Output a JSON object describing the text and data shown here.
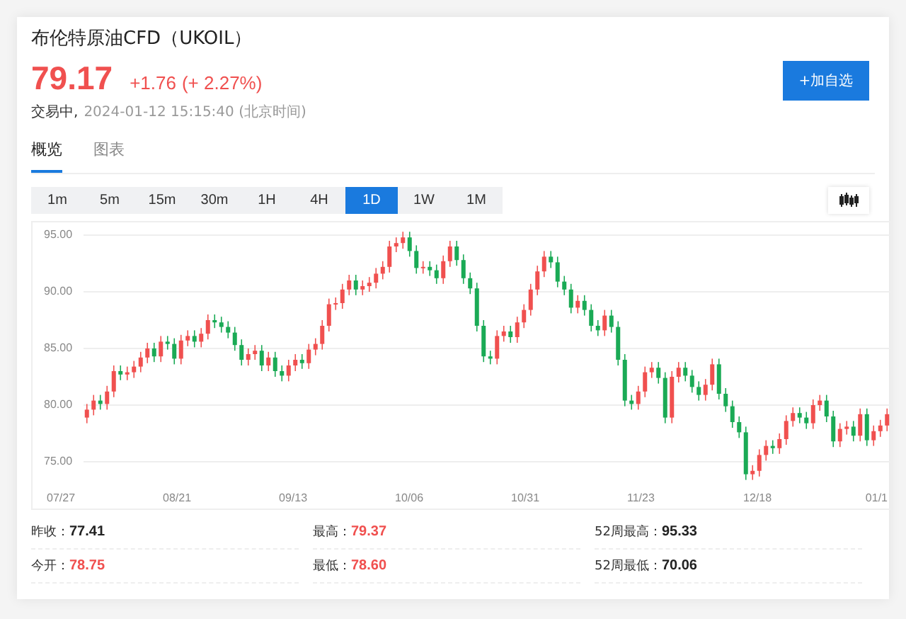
{
  "header": {
    "title": "布伦特原油CFD（UKOIL）",
    "price": "79.17",
    "change": "+1.76",
    "change_pct": "(+ 2.27%)",
    "color": "#f0504f",
    "status": "交易中,",
    "timestamp": "2024-01-12 15:15:40 (北京时间)",
    "watch_button": "+加自选"
  },
  "tabs": [
    {
      "label": "概览",
      "selected": true
    },
    {
      "label": "图表",
      "selected": false
    }
  ],
  "intervals": [
    {
      "label": "1m",
      "selected": false
    },
    {
      "label": "5m",
      "selected": false
    },
    {
      "label": "15m",
      "selected": false
    },
    {
      "label": "30m",
      "selected": false
    },
    {
      "label": "1H",
      "selected": false
    },
    {
      "label": "4H",
      "selected": false
    },
    {
      "label": "1D",
      "selected": true
    },
    {
      "label": "1W",
      "selected": false
    },
    {
      "label": "1M",
      "selected": false
    }
  ],
  "chart": {
    "x_labels": [
      "07/27",
      "08/21",
      "09/13",
      "10/06",
      "10/31",
      "11/23",
      "12/18",
      "01/1"
    ],
    "chart_data": {
      "type": "candlestick",
      "grid": true,
      "ylim": [
        70.875,
        96.125
      ],
      "yticks": [
        {
          "value": 95,
          "label": "95.00"
        },
        {
          "value": 90,
          "label": "90.00"
        },
        {
          "value": 85,
          "label": "85.00"
        },
        {
          "value": 80,
          "label": "80.00"
        },
        {
          "value": 75,
          "label": "75.00"
        }
      ],
      "ohlc": [
        [
          78.9,
          80.1,
          78.4,
          79.6
        ],
        [
          79.6,
          80.9,
          79.1,
          80.4
        ],
        [
          80.4,
          80.9,
          79.6,
          80.1
        ],
        [
          80.1,
          81.7,
          79.6,
          81.2
        ],
        [
          81.2,
          83.5,
          80.7,
          83.0
        ],
        [
          83.0,
          83.5,
          82.2,
          82.7
        ],
        [
          82.7,
          83.4,
          82.2,
          82.9
        ],
        [
          82.9,
          83.9,
          82.4,
          83.4
        ],
        [
          83.4,
          84.7,
          82.9,
          84.2
        ],
        [
          84.2,
          85.5,
          83.7,
          85.0
        ],
        [
          85.0,
          85.5,
          83.8,
          84.3
        ],
        [
          84.3,
          86.1,
          83.8,
          85.6
        ],
        [
          85.6,
          86.1,
          84.9,
          85.4
        ],
        [
          85.4,
          85.9,
          83.6,
          84.1
        ],
        [
          84.1,
          86.2,
          83.6,
          85.7
        ],
        [
          85.7,
          86.6,
          85.2,
          86.1
        ],
        [
          86.1,
          86.6,
          85.1,
          85.6
        ],
        [
          85.6,
          86.8,
          85.1,
          86.3
        ],
        [
          86.3,
          88.0,
          85.8,
          87.5
        ],
        [
          87.5,
          88.0,
          86.8,
          87.3
        ],
        [
          87.3,
          87.8,
          86.4,
          86.9
        ],
        [
          86.9,
          87.4,
          85.9,
          86.4
        ],
        [
          86.4,
          86.9,
          84.8,
          85.3
        ],
        [
          85.3,
          85.8,
          83.5,
          84.0
        ],
        [
          84.0,
          85.0,
          83.5,
          84.5
        ],
        [
          84.5,
          85.3,
          84.0,
          84.8
        ],
        [
          84.8,
          85.3,
          83.0,
          83.5
        ],
        [
          83.5,
          84.7,
          83.0,
          84.2
        ],
        [
          84.2,
          84.7,
          82.5,
          83.0
        ],
        [
          83.0,
          83.5,
          82.1,
          82.6
        ],
        [
          82.6,
          84.0,
          82.1,
          83.5
        ],
        [
          83.5,
          84.5,
          83.0,
          84.0
        ],
        [
          84.0,
          84.5,
          83.2,
          83.7
        ],
        [
          83.7,
          85.4,
          83.2,
          84.9
        ],
        [
          84.9,
          85.9,
          84.4,
          85.4
        ],
        [
          85.4,
          87.5,
          84.9,
          87.0
        ],
        [
          87.0,
          89.4,
          86.5,
          88.9
        ],
        [
          88.9,
          89.5,
          88.4,
          89.0
        ],
        [
          89.0,
          90.7,
          88.5,
          90.2
        ],
        [
          90.2,
          91.5,
          89.7,
          91.0
        ],
        [
          91.0,
          91.5,
          89.7,
          90.2
        ],
        [
          90.2,
          91.0,
          89.7,
          90.5
        ],
        [
          90.5,
          91.3,
          90.0,
          90.8
        ],
        [
          90.8,
          92.1,
          90.3,
          91.6
        ],
        [
          91.6,
          92.7,
          91.1,
          92.2
        ],
        [
          92.2,
          94.5,
          91.7,
          94.0
        ],
        [
          94.0,
          94.8,
          93.5,
          94.3
        ],
        [
          94.3,
          95.3,
          93.8,
          94.8
        ],
        [
          94.8,
          95.3,
          93.1,
          93.6
        ],
        [
          93.6,
          94.1,
          91.6,
          92.1
        ],
        [
          92.1,
          92.7,
          91.6,
          92.2
        ],
        [
          92.2,
          92.7,
          91.4,
          91.9
        ],
        [
          91.9,
          92.4,
          90.7,
          91.2
        ],
        [
          91.2,
          93.2,
          90.7,
          92.7
        ],
        [
          92.7,
          94.5,
          92.2,
          94.0
        ],
        [
          94.0,
          94.5,
          92.3,
          92.8
        ],
        [
          92.8,
          93.3,
          90.7,
          91.2
        ],
        [
          91.2,
          91.7,
          89.8,
          90.3
        ],
        [
          90.3,
          90.8,
          86.5,
          87.0
        ],
        [
          87.0,
          87.5,
          83.8,
          84.3
        ],
        [
          84.3,
          84.8,
          83.6,
          84.1
        ],
        [
          84.1,
          86.6,
          83.6,
          86.1
        ],
        [
          86.1,
          87.0,
          85.6,
          86.5
        ],
        [
          86.5,
          87.0,
          85.5,
          86.0
        ],
        [
          86.0,
          87.8,
          85.5,
          87.3
        ],
        [
          87.3,
          88.9,
          86.8,
          88.4
        ],
        [
          88.4,
          90.7,
          87.9,
          90.2
        ],
        [
          90.2,
          92.3,
          89.7,
          91.8
        ],
        [
          91.8,
          93.6,
          91.3,
          93.1
        ],
        [
          93.1,
          93.6,
          92.1,
          92.6
        ],
        [
          92.6,
          93.1,
          90.4,
          90.9
        ],
        [
          90.9,
          91.4,
          89.7,
          90.2
        ],
        [
          90.2,
          90.7,
          88.1,
          88.6
        ],
        [
          88.6,
          89.7,
          88.1,
          89.2
        ],
        [
          89.2,
          89.7,
          87.9,
          88.4
        ],
        [
          88.4,
          88.9,
          86.5,
          87.0
        ],
        [
          87.0,
          87.5,
          86.1,
          86.6
        ],
        [
          86.6,
          88.4,
          86.1,
          87.9
        ],
        [
          87.9,
          88.4,
          86.4,
          86.9
        ],
        [
          86.9,
          87.4,
          83.5,
          84.0
        ],
        [
          84.0,
          84.5,
          79.9,
          80.4
        ],
        [
          80.4,
          80.9,
          79.6,
          80.1
        ],
        [
          80.1,
          81.7,
          79.6,
          81.2
        ],
        [
          81.2,
          83.4,
          80.7,
          82.9
        ],
        [
          82.9,
          83.8,
          82.4,
          83.3
        ],
        [
          83.3,
          83.8,
          81.9,
          82.4
        ],
        [
          82.4,
          82.9,
          78.4,
          78.9
        ],
        [
          78.9,
          83.0,
          78.4,
          82.5
        ],
        [
          82.5,
          83.8,
          82.0,
          83.3
        ],
        [
          83.3,
          83.8,
          82.1,
          82.6
        ],
        [
          82.6,
          83.1,
          81.1,
          81.6
        ],
        [
          81.6,
          82.1,
          80.4,
          80.9
        ],
        [
          80.9,
          82.3,
          80.4,
          81.8
        ],
        [
          81.8,
          84.1,
          81.3,
          83.6
        ],
        [
          83.6,
          84.1,
          80.5,
          81.0
        ],
        [
          81.0,
          81.5,
          79.4,
          79.9
        ],
        [
          79.9,
          80.4,
          78.0,
          78.5
        ],
        [
          78.5,
          79.0,
          77.1,
          77.6
        ],
        [
          77.6,
          78.1,
          73.4,
          73.9
        ],
        [
          73.9,
          74.7,
          73.4,
          74.2
        ],
        [
          74.2,
          76.1,
          73.7,
          75.6
        ],
        [
          75.6,
          76.9,
          75.1,
          76.4
        ],
        [
          76.4,
          76.9,
          75.7,
          76.2
        ],
        [
          76.2,
          77.5,
          75.7,
          77.0
        ],
        [
          77.0,
          79.1,
          76.5,
          78.6
        ],
        [
          78.6,
          79.8,
          78.1,
          79.3
        ],
        [
          79.3,
          79.8,
          78.4,
          78.9
        ],
        [
          78.9,
          79.4,
          77.9,
          78.4
        ],
        [
          78.4,
          80.5,
          77.9,
          80.0
        ],
        [
          80.0,
          80.9,
          79.5,
          80.4
        ],
        [
          80.4,
          80.9,
          78.5,
          79.0
        ],
        [
          79.0,
          79.5,
          76.3,
          76.8
        ],
        [
          76.8,
          78.4,
          76.3,
          77.9
        ],
        [
          77.9,
          78.6,
          77.4,
          78.1
        ],
        [
          78.1,
          78.6,
          76.8,
          77.3
        ],
        [
          77.3,
          79.7,
          76.8,
          79.2
        ],
        [
          79.2,
          79.7,
          76.4,
          76.9
        ],
        [
          76.9,
          78.2,
          76.4,
          77.7
        ],
        [
          77.7,
          78.7,
          77.2,
          78.2
        ],
        [
          78.2,
          79.7,
          77.7,
          79.2
        ]
      ]
    }
  },
  "stats": [
    {
      "label": "昨收：",
      "value": "77.41",
      "color": "#222222"
    },
    {
      "label": "最高：",
      "value": "79.37",
      "color": "#f0504f"
    },
    {
      "label": "52周最高：",
      "value": "95.33",
      "color": "#222222"
    },
    {
      "label": "今开：",
      "value": "78.75",
      "color": "#f0504f"
    },
    {
      "label": "最低：",
      "value": "78.60",
      "color": "#f0504f"
    },
    {
      "label": "52周最低：",
      "value": "70.06",
      "color": "#222222"
    }
  ]
}
